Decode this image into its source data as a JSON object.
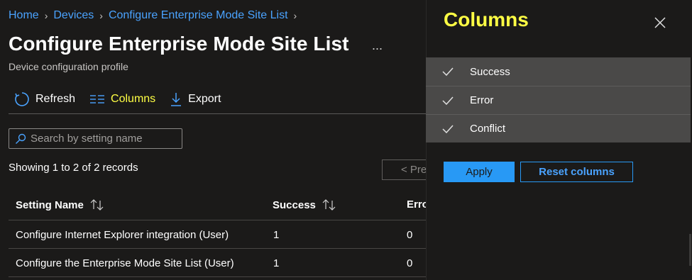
{
  "breadcrumb": {
    "items": [
      "Home",
      "Devices",
      "Configure Enterprise Mode Site List"
    ]
  },
  "page": {
    "title": "Configure Enterprise Mode Site List",
    "more_label": "...",
    "subtitle": "Device configuration profile"
  },
  "toolbar": {
    "refresh_label": "Refresh",
    "columns_label": "Columns",
    "export_label": "Export"
  },
  "search": {
    "placeholder": "Search by setting name"
  },
  "records": {
    "text": "Showing 1 to 2 of 2 records",
    "prev_label": "< Pre"
  },
  "table": {
    "headers": [
      "Setting Name",
      "Success",
      "Erro"
    ],
    "rows": [
      [
        "Configure Internet Explorer integration (User)",
        "1",
        "0"
      ],
      [
        "Configure the Enterprise Mode Site List (User)",
        "1",
        "0"
      ]
    ]
  },
  "columns_panel": {
    "title": "Columns",
    "items": [
      "Success",
      "Error",
      "Conflict"
    ],
    "apply_label": "Apply",
    "reset_label": "Reset columns"
  },
  "colors": {
    "accent": "#2899f5",
    "link": "#4aa3ff",
    "highlight": "#ffff44",
    "background": "#1b1a19"
  }
}
